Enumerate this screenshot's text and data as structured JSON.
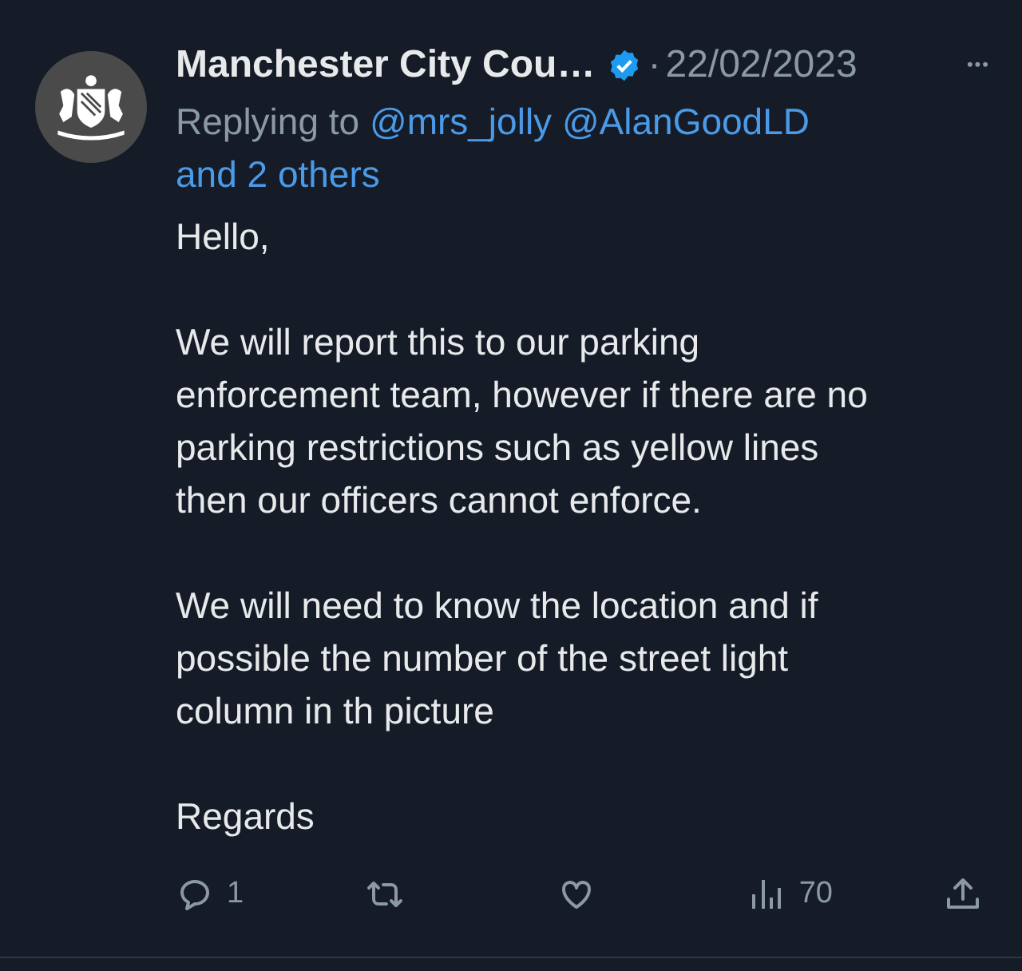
{
  "author": {
    "name": "Manchester City Cou…",
    "verified": true,
    "separator": "·",
    "date": "22/02/2023",
    "more": "•••"
  },
  "replying_to": {
    "prefix": "Replying to",
    "mentions": [
      "@mrs_jolly",
      "@AlanGoodLD"
    ],
    "others": "and 2 others"
  },
  "body": [
    {
      "lines": [
        "Hello,"
      ]
    },
    {
      "lines": [
        "We will report this to our parking",
        "enforcement team, however if there are no",
        "parking restrictions such as yellow lines",
        "then our officers cannot enforce."
      ]
    },
    {
      "lines": [
        "We will need to know the location and if",
        "possible the number of the street light",
        "column in th picture"
      ]
    },
    {
      "lines": [
        "Regards"
      ]
    }
  ],
  "actions": [
    {
      "kind": "reply",
      "count": "1"
    },
    {
      "kind": "retweet"
    },
    {
      "kind": "like"
    },
    {
      "kind": "views",
      "count": "70"
    },
    {
      "kind": "share"
    }
  ]
}
